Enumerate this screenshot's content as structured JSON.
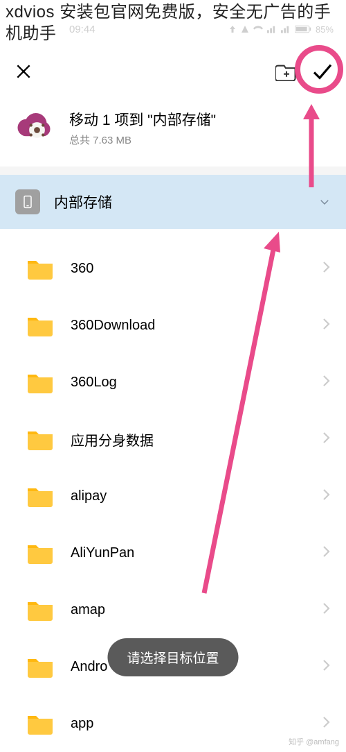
{
  "overlay_title": "xdvios 安装包官网免费版，安全无广告的手机助手",
  "status": {
    "time": "09:44",
    "battery": "85%"
  },
  "move": {
    "title": "移动 1 项到 \"内部存储\"",
    "subtitle": "总共 7.63 MB"
  },
  "storage": {
    "label": "内部存储"
  },
  "folders": [
    {
      "name": "360"
    },
    {
      "name": "360Download"
    },
    {
      "name": "360Log"
    },
    {
      "name": "应用分身数据"
    },
    {
      "name": "alipay"
    },
    {
      "name": "AliYunPan"
    },
    {
      "name": "amap"
    },
    {
      "name": "Andro"
    },
    {
      "name": "app"
    }
  ],
  "toast": "请选择目标位置",
  "watermark": "知乎 @amfang"
}
